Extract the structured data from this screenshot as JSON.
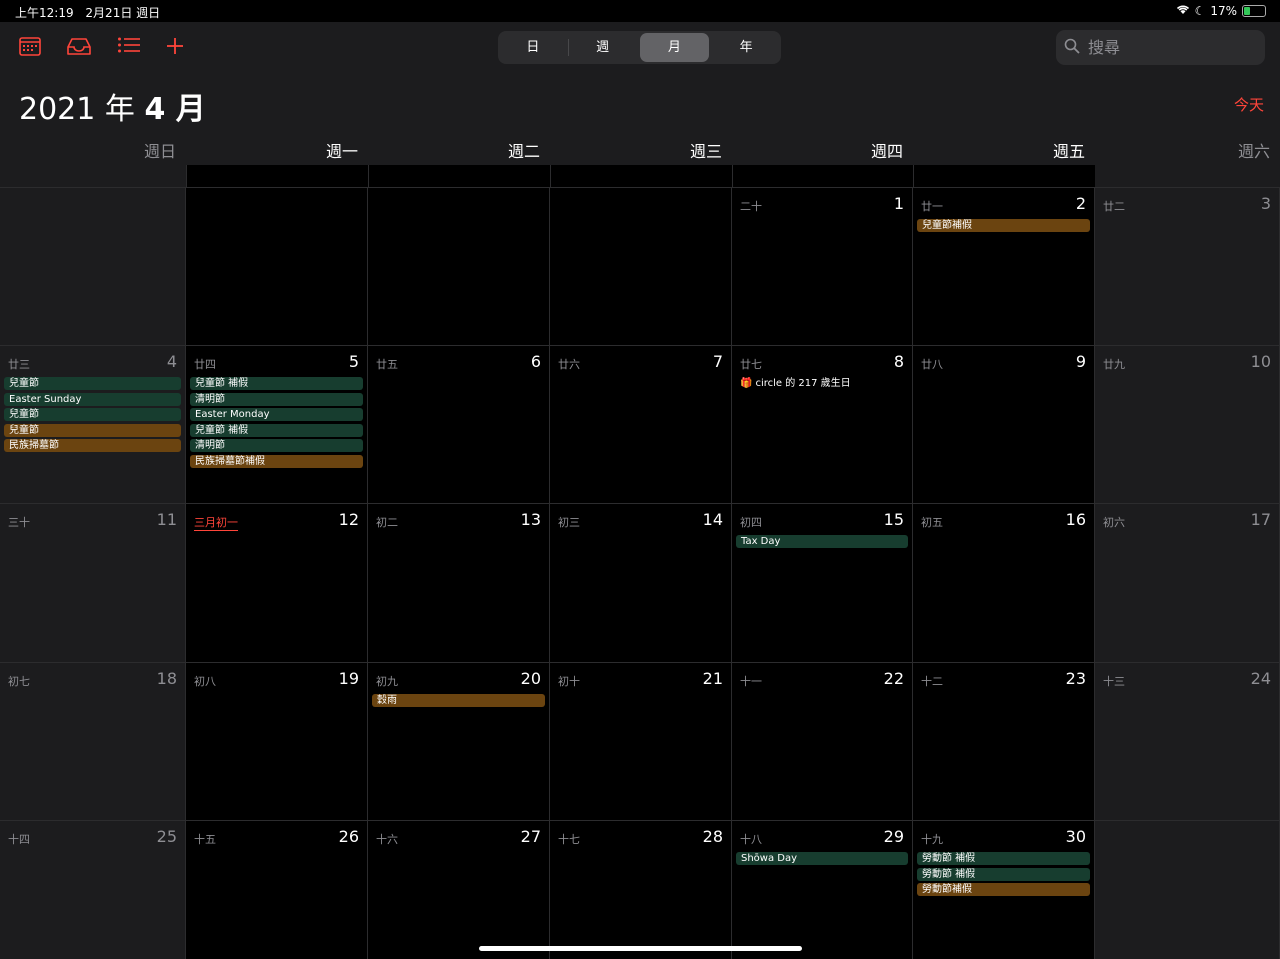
{
  "status": {
    "time": "上午12:19",
    "date": "2月21日 週日",
    "battery": "17%"
  },
  "toolbar": {
    "icons": [
      "calendar-icon",
      "inbox-icon",
      "list-icon",
      "plus-icon"
    ],
    "views": [
      "日",
      "週",
      "月",
      "年"
    ],
    "active_view": "月",
    "search_placeholder": "搜尋",
    "today": "今天"
  },
  "title": {
    "year": "2021 年",
    "month": "4 月"
  },
  "weekdays": [
    "週日",
    "週一",
    "週二",
    "週三",
    "週四",
    "週五",
    "週六"
  ],
  "weeks": [
    [
      null,
      null,
      null,
      null,
      {
        "day": "1",
        "lunar": "二十",
        "events": []
      },
      {
        "day": "2",
        "lunar": "廿一",
        "events": [
          {
            "title": "兒童節補假",
            "color": "orange"
          }
        ]
      },
      {
        "day": "3",
        "lunar": "廿二",
        "events": []
      }
    ],
    [
      {
        "day": "4",
        "lunar": "廿三",
        "events": [
          {
            "title": "兒童節",
            "color": "green"
          },
          {
            "title": "Easter Sunday",
            "color": "green"
          },
          {
            "title": "兒童節",
            "color": "green"
          },
          {
            "title": "兒童節",
            "color": "orange"
          },
          {
            "title": "民族掃墓節",
            "color": "orange"
          }
        ]
      },
      {
        "day": "5",
        "lunar": "廿四",
        "events": [
          {
            "title": "兒童節 補假",
            "color": "green"
          },
          {
            "title": "清明節",
            "color": "green"
          },
          {
            "title": "Easter Monday",
            "color": "green"
          },
          {
            "title": "兒童節 補假",
            "color": "green"
          },
          {
            "title": "清明節",
            "color": "green"
          },
          {
            "title": "民族掃墓節補假",
            "color": "orange"
          }
        ]
      },
      {
        "day": "6",
        "lunar": "廿五",
        "events": []
      },
      {
        "day": "7",
        "lunar": "廿六",
        "events": []
      },
      {
        "day": "8",
        "lunar": "廿七",
        "events": [
          {
            "title": "circle 的 217 歲生日",
            "color": "plain",
            "icon": "gift-icon"
          }
        ]
      },
      {
        "day": "9",
        "lunar": "廿八",
        "events": []
      },
      {
        "day": "10",
        "lunar": "廿九",
        "events": []
      }
    ],
    [
      {
        "day": "11",
        "lunar": "三十",
        "events": []
      },
      {
        "day": "12",
        "lunar": "三月初一",
        "lunar_highlight": true,
        "events": []
      },
      {
        "day": "13",
        "lunar": "初二",
        "events": []
      },
      {
        "day": "14",
        "lunar": "初三",
        "events": []
      },
      {
        "day": "15",
        "lunar": "初四",
        "events": [
          {
            "title": "Tax Day",
            "color": "green"
          }
        ]
      },
      {
        "day": "16",
        "lunar": "初五",
        "events": []
      },
      {
        "day": "17",
        "lunar": "初六",
        "events": []
      }
    ],
    [
      {
        "day": "18",
        "lunar": "初七",
        "events": []
      },
      {
        "day": "19",
        "lunar": "初八",
        "events": []
      },
      {
        "day": "20",
        "lunar": "初九",
        "events": [
          {
            "title": "穀雨",
            "color": "orange"
          }
        ]
      },
      {
        "day": "21",
        "lunar": "初十",
        "events": []
      },
      {
        "day": "22",
        "lunar": "十一",
        "events": []
      },
      {
        "day": "23",
        "lunar": "十二",
        "events": []
      },
      {
        "day": "24",
        "lunar": "十三",
        "events": []
      }
    ],
    [
      {
        "day": "25",
        "lunar": "十四",
        "events": []
      },
      {
        "day": "26",
        "lunar": "十五",
        "events": []
      },
      {
        "day": "27",
        "lunar": "十六",
        "events": []
      },
      {
        "day": "28",
        "lunar": "十七",
        "events": []
      },
      {
        "day": "29",
        "lunar": "十八",
        "events": [
          {
            "title": "Shōwa Day",
            "color": "green"
          }
        ]
      },
      {
        "day": "30",
        "lunar": "十九",
        "events": [
          {
            "title": "勞動節 補假",
            "color": "green"
          },
          {
            "title": "勞動節 補假",
            "color": "green"
          },
          {
            "title": "勞動節補假",
            "color": "orange"
          }
        ]
      },
      null
    ]
  ]
}
